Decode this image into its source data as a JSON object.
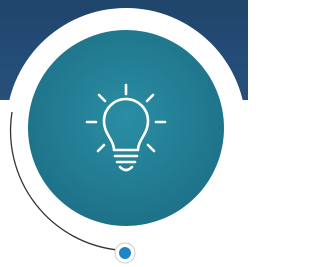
{
  "colors": {
    "band": "#234c77",
    "ring_fill": "#ffffff",
    "ring_outline": "#222222",
    "badge_fill": "#1f7e95",
    "icon_stroke": "#ffffff",
    "node_fill": "#1f86c4",
    "node_ring": "#ffffff"
  },
  "icon": {
    "name": "lightbulb-icon"
  }
}
